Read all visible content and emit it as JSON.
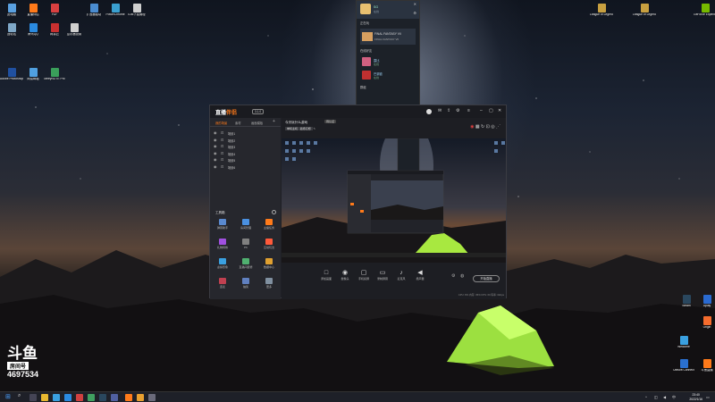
{
  "desktop": {
    "left_icons": [
      {
        "label": "此电脑",
        "color": "#5aa0e0"
      },
      {
        "label": "直播伴侣",
        "color": "#ff7a1a"
      },
      {
        "label": "PDF",
        "color": "#d94040"
      },
      {
        "label": "扩音器驱动",
        "color": "#4a8cd0"
      },
      {
        "label": "PowerChrome",
        "color": "#3aa0d0"
      },
      {
        "label": "IDM下载管理",
        "color": "#d0d0d0"
      },
      {
        "label": "回收站",
        "color": "#7fa8c8"
      },
      {
        "label": "腾讯QQ",
        "color": "#2a8ae0"
      },
      {
        "label": "网易云",
        "color": "#c83030"
      },
      {
        "label": "显示器设置",
        "color": "#d0d0d0"
      },
      {
        "label": "Adobe Photoshop",
        "color": "#2050a0"
      },
      {
        "label": "网易邮箱",
        "color": "#50a0e0"
      },
      {
        "label": "MeeyNOTE Pro",
        "color": "#3a9f5a"
      }
    ],
    "right_icons": [
      {
        "label": "League of Legends",
        "color": "#c8a040"
      },
      {
        "label": "League of Legends",
        "color": "#c8a040"
      },
      {
        "label": "GeForce Experience",
        "color": "#76b900"
      },
      {
        "label": "Steam",
        "color": "#2a475e"
      },
      {
        "label": "Uplay",
        "color": "#2a6ad0"
      },
      {
        "label": "Origin",
        "color": "#f56c2d"
      },
      {
        "label": "Welcome",
        "color": "#3aa0e0"
      },
      {
        "label": "Ubisoft Connect",
        "color": "#2a70d0"
      },
      {
        "label": "斗鱼直播",
        "color": "#ff7a1a"
      }
    ]
  },
  "watermark": {
    "logo": "斗鱼",
    "room_label": "房间号",
    "room_number": "4697534"
  },
  "steam": {
    "username": "SG",
    "status": "在线",
    "now_playing_section": "正在玩",
    "game": "FINAL FANTASY VII",
    "game_status": "游戏中",
    "game_sub": "FINAL FANTASY VII",
    "friends_section": "在线好友",
    "friends": [
      {
        "name": "露比",
        "status": "在线",
        "color": "#d06080"
      },
      {
        "name": "巴黎欧",
        "status": "在线",
        "color": "#c03030"
      }
    ],
    "groups_section": "群组"
  },
  "app": {
    "logo_text": "直播",
    "logo_accent": "伴侣",
    "version": "3.1.0",
    "tabs": [
      "我的场景",
      "素材",
      "画面模板"
    ],
    "scenes": [
      "场景1",
      "场景2",
      "场景3",
      "场景4",
      "场景5",
      "场景6"
    ],
    "tools_title": "工具箱",
    "tools": [
      {
        "label": "弹幕助手",
        "color": "#5a8ad0"
      },
      {
        "label": "房间管理",
        "color": "#4a90e0"
      },
      {
        "label": "主播任务",
        "color": "#ff7a1a"
      },
      {
        "label": "礼物特效",
        "color": "#a050e0"
      },
      {
        "label": "PK",
        "color": "#808080"
      },
      {
        "label": "互动玩法",
        "color": "#ff5a3a"
      },
      {
        "label": "虚拟形象",
        "color": "#3aa0e0"
      },
      {
        "label": "直播间装修",
        "color": "#50b070"
      },
      {
        "label": "数据中心",
        "color": "#e0a030"
      },
      {
        "label": "连麦",
        "color": "#c04050"
      },
      {
        "label": "抽奖",
        "color": "#6080c0"
      },
      {
        "label": "更多",
        "color": "#8090a0"
      }
    ],
    "stream_title": "今天玩什么游戏",
    "stream_tag": "待认证",
    "category": "单机主机 · 最终幻想",
    "bottom_bar": [
      {
        "label": "添加画面",
        "icon": "□"
      },
      {
        "label": "摄像头",
        "icon": "◉"
      },
      {
        "label": "手机投屏",
        "icon": "▢"
      },
      {
        "label": "录制屏幕",
        "icon": "▭"
      },
      {
        "label": "麦克风",
        "icon": "♪"
      },
      {
        "label": "扬声器",
        "icon": "◀"
      }
    ],
    "go_live_label": "开始直播",
    "status_line": "CPU: 8%  内存: 35%  FPS: 60  码率: 0kbps"
  },
  "taskbar": {
    "time": "23:40",
    "date": "2022/1/16"
  }
}
